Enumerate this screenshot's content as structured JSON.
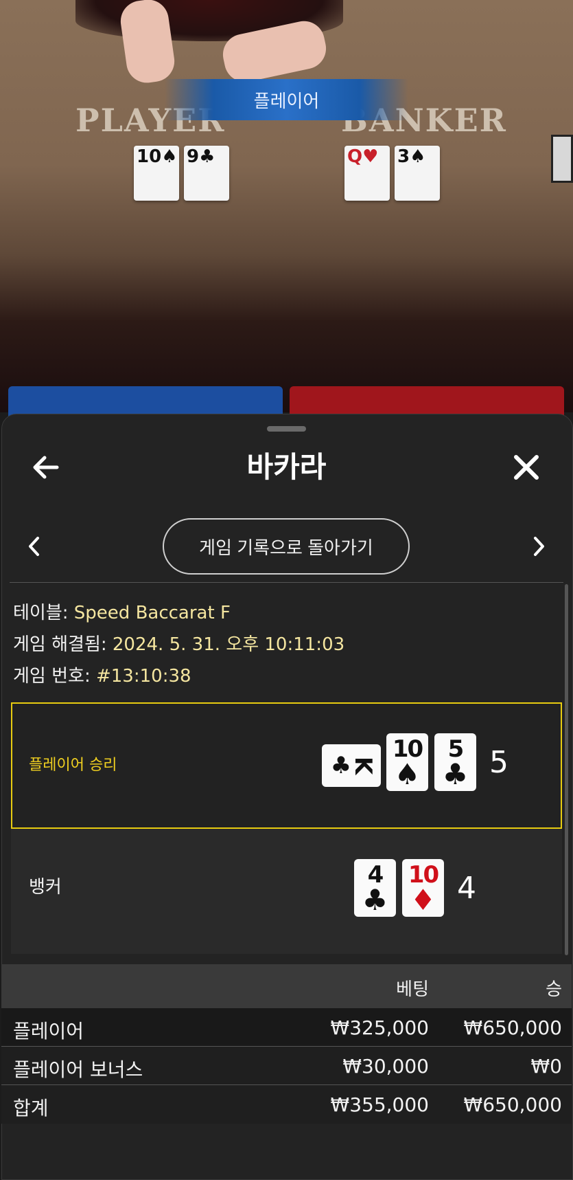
{
  "video": {
    "result_banner": "플레이어",
    "table_player_word": "PLAYER",
    "table_banker_word": "BANKER",
    "player_cards": [
      {
        "rank": "10",
        "suit": "♠"
      },
      {
        "rank": "9",
        "suit": "♣"
      }
    ],
    "banker_cards": [
      {
        "rank": "Q",
        "suit": "♥"
      },
      {
        "rank": "3",
        "suit": "♠"
      }
    ]
  },
  "header": {
    "title": "바카라",
    "back_icon": "arrow-left-icon",
    "close_icon": "close-icon"
  },
  "nav": {
    "back_to_history_label": "게임 기록으로 돌아가기",
    "prev_icon": "chevron-left-icon",
    "next_icon": "chevron-right-icon"
  },
  "info": {
    "table_label": "테이블: ",
    "table_value": "Speed Baccarat F",
    "resolved_label": "게임 해결됨: ",
    "resolved_value": "2024. 5. 31. 오후 10:11:03",
    "game_no_label": "게임 번호: ",
    "game_no_value": "#13:10:38"
  },
  "result": {
    "player_label": "플레이어 승리",
    "player_score": "5",
    "player_cards": [
      {
        "rank": "K",
        "suit": "♣",
        "color": "black",
        "rotated": true
      },
      {
        "rank": "10",
        "suit": "♠",
        "color": "black"
      },
      {
        "rank": "5",
        "suit": "♣",
        "color": "black"
      }
    ],
    "banker_label": "뱅커",
    "banker_score": "4",
    "banker_cards": [
      {
        "rank": "4",
        "suit": "♣",
        "color": "black"
      },
      {
        "rank": "10",
        "suit": "♦",
        "color": "red"
      }
    ],
    "highlight_color": "#e8cc10"
  },
  "bets": {
    "col_bet": "베팅",
    "col_win": "승",
    "rows": [
      {
        "name": "플레이어",
        "bet": "₩325,000",
        "win": "₩650,000"
      },
      {
        "name": "플레이어 보너스",
        "bet": "₩30,000",
        "win": "₩0"
      },
      {
        "name": "합계",
        "bet": "₩355,000",
        "win": "₩650,000"
      }
    ]
  }
}
